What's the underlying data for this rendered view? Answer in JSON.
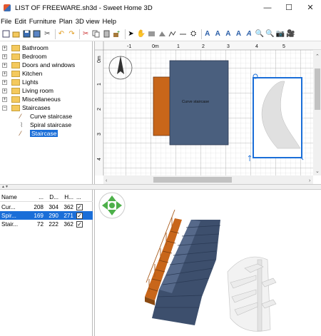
{
  "window": {
    "title": "LIST OF FREEWARE.sh3d - Sweet Home 3D",
    "minimize": "—",
    "maximize": "☐",
    "close": "✕"
  },
  "menu": [
    "File",
    "Edit",
    "Furniture",
    "Plan",
    "3D view",
    "Help"
  ],
  "toolbar": {
    "icons": [
      "new-home-icon",
      "open-icon",
      "save-icon",
      "cut-icon",
      "undo-icon",
      "redo-icon",
      "cut2-icon",
      "copy-icon",
      "paste-icon",
      "add-furniture-icon",
      "select-icon",
      "pan-icon",
      "create-walls-icon",
      "create-rooms-icon",
      "create-polylines-icon",
      "create-dimensions-icon",
      "add-text-icon",
      "text-style-icon",
      "increase-text-icon",
      "decrease-text-icon",
      "bold-icon",
      "italic-icon",
      "zoom-in-icon",
      "zoom-out-icon",
      "create-photo-icon",
      "create-video-icon"
    ]
  },
  "tree": {
    "categories": [
      {
        "label": "Bathroom",
        "expanded": false
      },
      {
        "label": "Bedroom",
        "expanded": false
      },
      {
        "label": "Doors and windows",
        "expanded": false
      },
      {
        "label": "Kitchen",
        "expanded": false
      },
      {
        "label": "Lights",
        "expanded": false
      },
      {
        "label": "Living room",
        "expanded": false
      },
      {
        "label": "Miscellaneous",
        "expanded": false
      },
      {
        "label": "Staircases",
        "expanded": true
      }
    ],
    "items": [
      {
        "label": "Curve staircase",
        "selected": false
      },
      {
        "label": "Spiral staircase",
        "selected": false
      },
      {
        "label": "Staircase",
        "selected": true
      }
    ]
  },
  "furniture_table": {
    "headers": [
      "Name",
      "...",
      "D...",
      "H...",
      "..."
    ],
    "rows": [
      {
        "name": "Cur...",
        "w": "208",
        "d": "304",
        "h": "362",
        "visible": true,
        "selected": false
      },
      {
        "name": "Spir...",
        "w": "169",
        "d": "290",
        "h": "271",
        "visible": true,
        "selected": true
      },
      {
        "name": "Stair...",
        "w": "72",
        "d": "222",
        "h": "362",
        "visible": true,
        "selected": false
      }
    ]
  },
  "plan": {
    "ruler_labels": [
      "-1",
      "0m",
      "1",
      "2",
      "3",
      "4",
      "5"
    ],
    "vertical_ruler_labels": [
      "0m",
      "1",
      "2",
      "3",
      "4"
    ],
    "curve_staircase_label": "Curve staircase"
  },
  "colors": {
    "selection": "#1a6ed8",
    "stair_blue": "#4a5f7e",
    "stair_orange": "#c8661a",
    "folder": "#f4c95d"
  }
}
